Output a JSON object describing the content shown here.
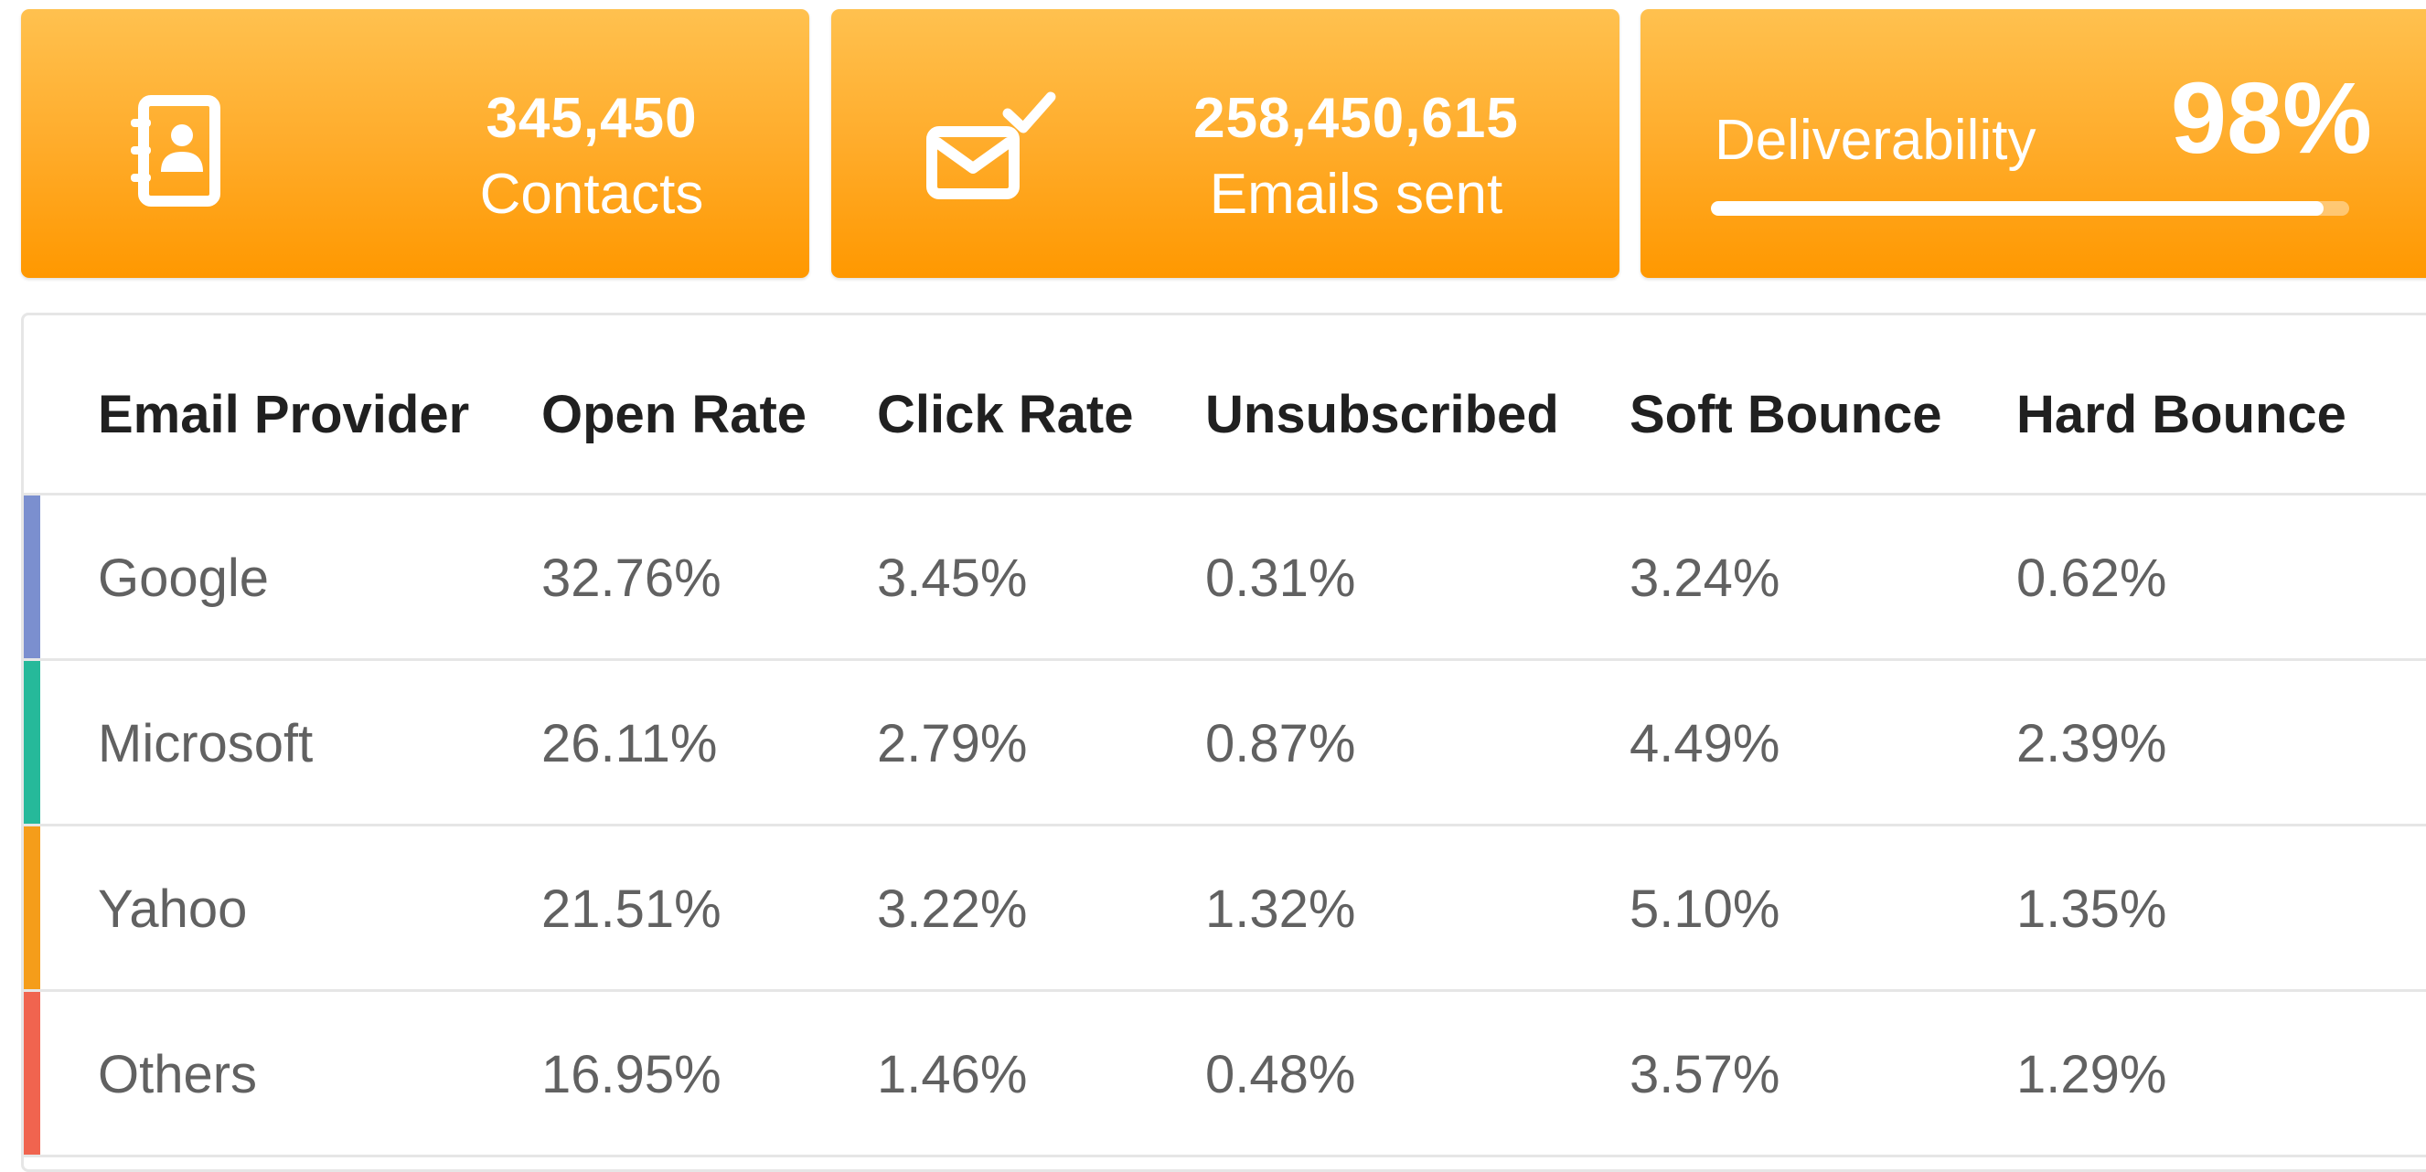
{
  "stats": {
    "contacts": {
      "icon": "address-book-icon",
      "value": "345,450",
      "label": "Contacts"
    },
    "emails": {
      "icon": "email-sent-check-icon",
      "value": "258,450,615",
      "label": "Emails sent"
    },
    "deliverability": {
      "label": "Deliverability",
      "value": "98%",
      "progress": 0.96
    }
  },
  "colors": {
    "card_top": "#ffc14f",
    "card_bottom": "#ff9800"
  },
  "table": {
    "headers": [
      "Email Provider",
      "Open Rate",
      "Click Rate",
      "Unsubscribed",
      "Soft Bounce",
      "Hard Bounce"
    ],
    "rows": [
      {
        "provider": "Google",
        "color": "#7b8fcf",
        "open": "32.76%",
        "click": "3.45%",
        "unsub": "0.31%",
        "soft": "3.24%",
        "hard": "0.62%"
      },
      {
        "provider": "Microsoft",
        "color": "#26b99a",
        "open": "26.11%",
        "click": "2.79%",
        "unsub": "0.87%",
        "soft": "4.49%",
        "hard": "2.39%"
      },
      {
        "provider": "Yahoo",
        "color": "#f59d1a",
        "open": "21.51%",
        "click": "3.22%",
        "unsub": "1.32%",
        "soft": "5.10%",
        "hard": "1.35%"
      },
      {
        "provider": "Others",
        "color": "#f0644f",
        "open": "16.95%",
        "click": "1.46%",
        "unsub": "0.48%",
        "soft": "3.57%",
        "hard": "1.29%"
      }
    ]
  }
}
